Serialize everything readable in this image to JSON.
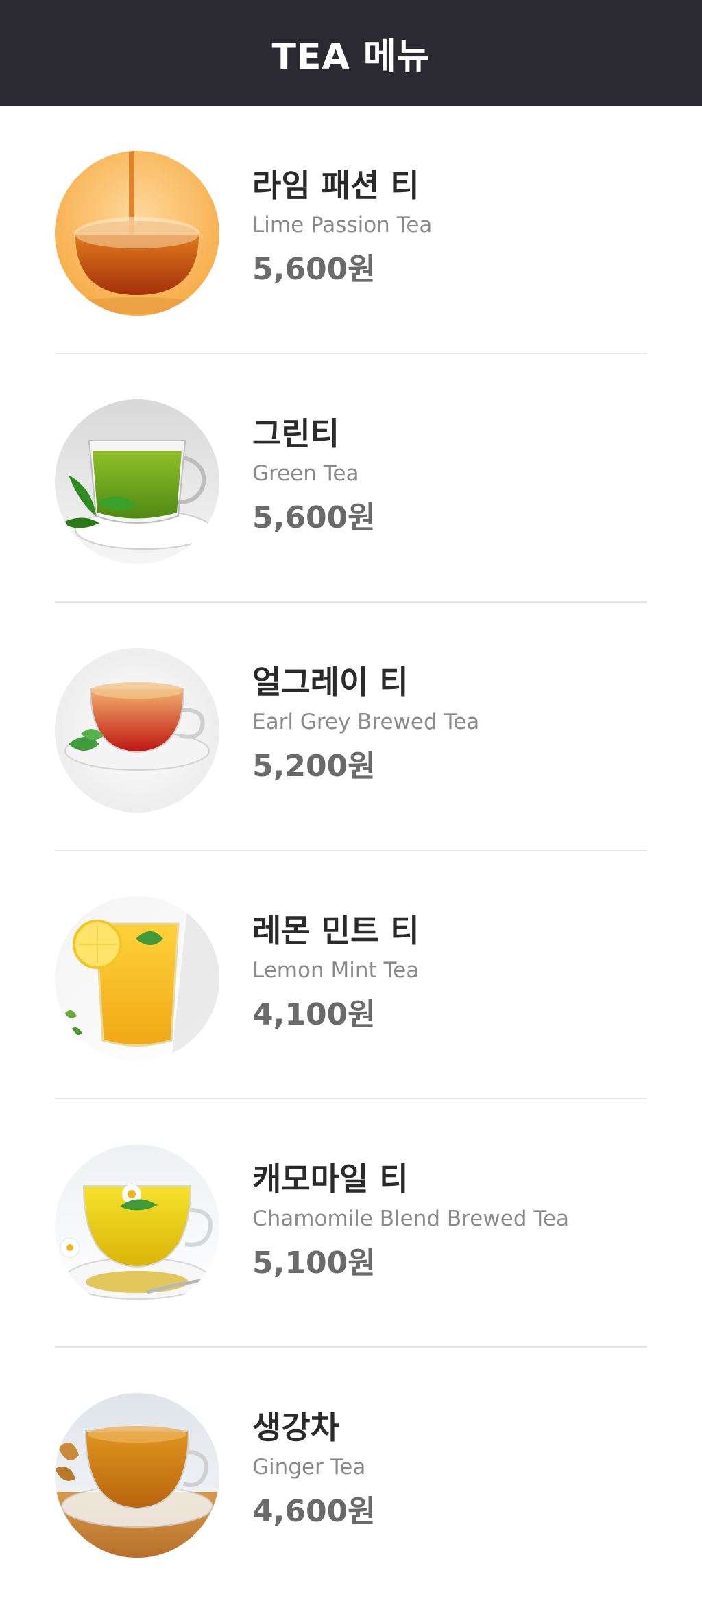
{
  "header": {
    "title": "TEA 메뉴"
  },
  "items": [
    {
      "name_ko": "라임 패션 티",
      "name_en": "Lime Passion Tea",
      "price": "5,600원",
      "image": "lime-passion-tea-image"
    },
    {
      "name_ko": "그린티",
      "name_en": "Green Tea",
      "price": "5,600원",
      "image": "green-tea-image"
    },
    {
      "name_ko": "얼그레이 티",
      "name_en": "Earl Grey Brewed Tea",
      "price": "5,200원",
      "image": "earl-grey-tea-image"
    },
    {
      "name_ko": "레몬 민트 티",
      "name_en": "Lemon Mint Tea",
      "price": "4,100원",
      "image": "lemon-mint-tea-image"
    },
    {
      "name_ko": "캐모마일 티",
      "name_en": "Chamomile Blend Brewed Tea",
      "price": "5,100원",
      "image": "chamomile-tea-image"
    },
    {
      "name_ko": "생강차",
      "name_en": "Ginger Tea",
      "price": "4,600원",
      "image": "ginger-tea-image"
    }
  ],
  "colors": {
    "header_bg": "#2b2a33",
    "divider": "#e4e4e4",
    "name": "#2a2a2a",
    "subtitle": "#8a8a8a",
    "price": "#6a6a6a"
  }
}
